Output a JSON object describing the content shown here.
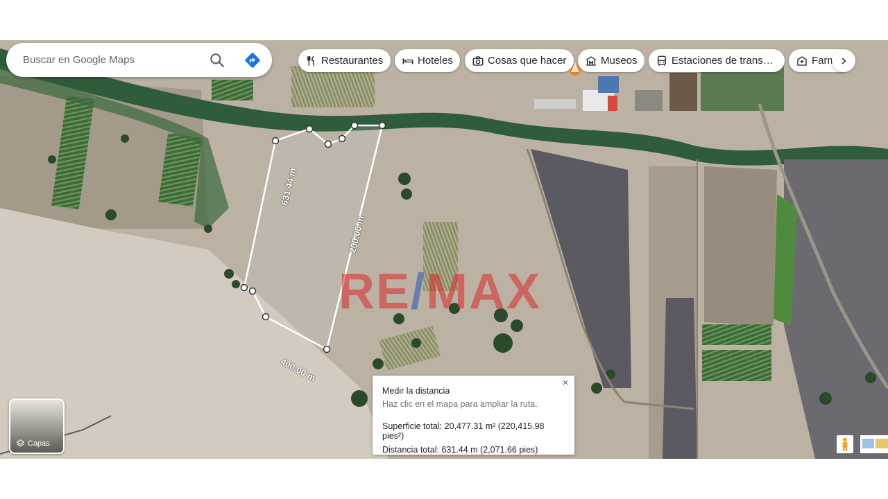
{
  "search": {
    "placeholder": "Buscar en Google Maps"
  },
  "chips": [
    {
      "label": "Restaurantes",
      "icon": "fork-knife-icon"
    },
    {
      "label": "Hoteles",
      "icon": "bed-icon"
    },
    {
      "label": "Cosas que hacer",
      "icon": "camera-icon"
    },
    {
      "label": "Museos",
      "icon": "museum-icon"
    },
    {
      "label": "Estaciones de trans…",
      "icon": "bus-icon"
    },
    {
      "label": "Farm",
      "icon": "pharmacy-icon"
    }
  ],
  "measure_labels": [
    "631.44 m",
    "200.00 m",
    "400.00 m"
  ],
  "watermark": {
    "left": "RE",
    "slash": "/",
    "right": "MAX"
  },
  "measure_card": {
    "title": "Medir la distancia",
    "hint": "Haz clic en el mapa para ampliar la ruta.",
    "area": "Superficie total: 20,477.31 m² (220,415.98 pies²)",
    "distance": "Distancia total: 631.44 m (2,071.66 pies)",
    "close": "×"
  },
  "layers": {
    "label": "Capas"
  },
  "colors": {
    "accent": "#1a73e8",
    "measure_line": "#ffffff"
  }
}
